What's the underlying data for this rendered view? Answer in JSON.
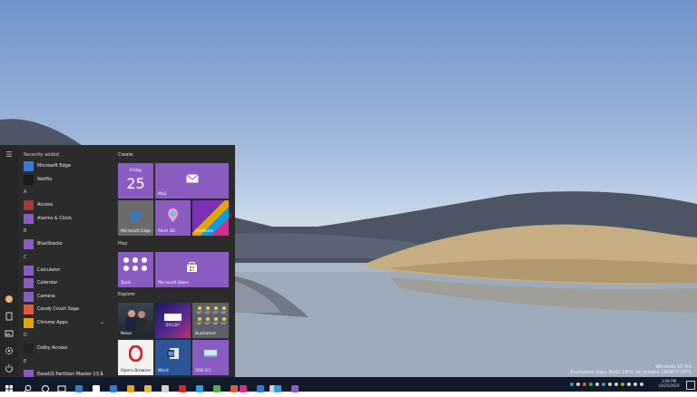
{
  "desktop": {
    "watermark_line1": "Windows 10 Pro",
    "watermark_line2": "Evaluation copy. Build 19H1.ob_release.190917-1675"
  },
  "rail_icons": [
    "menu-icon",
    "user-icon",
    "document-icon",
    "pictures-icon",
    "settings-icon",
    "power-icon"
  ],
  "app_list": {
    "recently_added": "Recently added",
    "items": [
      {
        "label": "Microsoft Edge",
        "color": "#3a7bd5"
      },
      {
        "label": "Netflix",
        "color": "#1a1a1a"
      },
      {
        "header": "A"
      },
      {
        "label": "Access",
        "color": "#a4373a"
      },
      {
        "label": "Alarms & Clock",
        "color": "#8a5cc2"
      },
      {
        "header": "B"
      },
      {
        "label": "BlueStacks",
        "color": "#8a5cc2"
      },
      {
        "header": "C"
      },
      {
        "label": "Calculator",
        "color": "#8a5cc2"
      },
      {
        "label": "Calendar",
        "color": "#8a5cc2"
      },
      {
        "label": "Camera",
        "color": "#8a5cc2"
      },
      {
        "label": "Candy Crush Saga",
        "color": "#e05a3a"
      },
      {
        "label": "Chrome Apps",
        "color": "#e0a800",
        "chevron": true
      },
      {
        "header": "D"
      },
      {
        "label": "Dolby Access",
        "color": "#222222"
      },
      {
        "header": "E"
      },
      {
        "label": "EaseUS Partition Master 13.5",
        "color": "#8a5cc2",
        "chevron": true
      }
    ]
  },
  "tiles": {
    "groups": {
      "create": "Create",
      "play": "Play",
      "explore": "Explore"
    },
    "calendar_day": "Friday",
    "calendar_date": "25",
    "mail": "Mail",
    "edge": "Microsoft Edge",
    "paint3d": "Paint 3D",
    "onenote": "OneNote",
    "tools": "Tools",
    "store": "Microsoft Store",
    "news": "News",
    "dolby": "DOLBY",
    "weather_days": [
      "16°",
      "19°",
      "15°",
      "16°",
      "18°",
      "12°",
      "16°",
      "15°"
    ],
    "weather_city": "Bucharest",
    "opera": "Opera Browser",
    "word": "Word",
    "ssd": "SSD (C)"
  },
  "taskbar": {
    "icons": [
      "start-icon",
      "search-icon",
      "cortana-icon",
      "task-view-icon",
      "edge-icon",
      "store-icon",
      "mail-icon",
      "chrome-icon",
      "explorer-icon",
      "settings-icon",
      "opera-icon",
      "photos-icon",
      "xbox-icon",
      "music-icon",
      "paint-icon",
      "gear-icon",
      "outlook-icon",
      "maps-icon",
      "teams-icon"
    ],
    "time": "3:06 PM",
    "date": "10/25/2019"
  }
}
